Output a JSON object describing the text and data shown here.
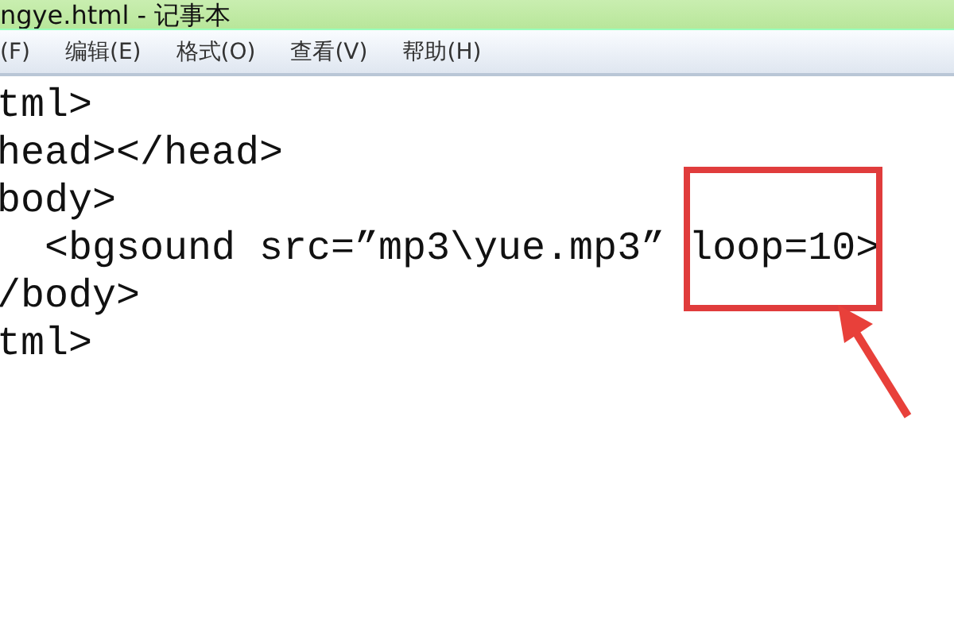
{
  "window": {
    "title": "ngye.html - 记事本"
  },
  "menu": [
    "(F)",
    "编辑(E)",
    "格式(O)",
    "查看(V)",
    "帮助(H)"
  ],
  "lines": [
    "tml>",
    "head></head>",
    "body>",
    "  <bgsound src=”mp3\\yue.mp3” loop=10>",
    "/body>",
    "tml>"
  ]
}
